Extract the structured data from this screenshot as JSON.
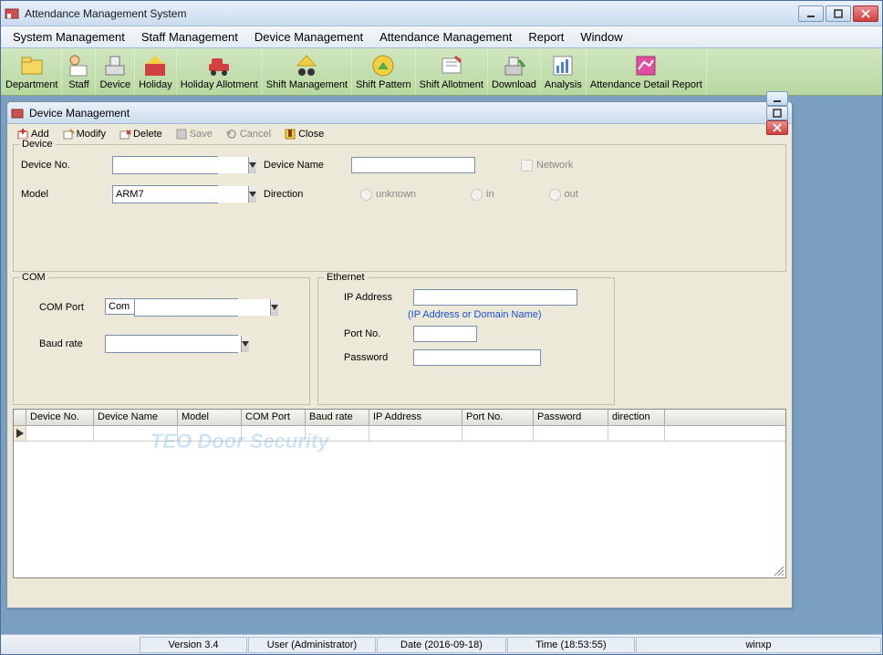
{
  "main_title": "Attendance Management System",
  "menubar": [
    "System Management",
    "Staff Management",
    "Device Management",
    "Attendance Management",
    "Report",
    "Window"
  ],
  "toolbar": [
    {
      "label": "Department",
      "icon": "dept"
    },
    {
      "label": "Staff",
      "icon": "staff"
    },
    {
      "label": "Device",
      "icon": "device"
    },
    {
      "label": "Holiday",
      "icon": "holiday"
    },
    {
      "label": "Holiday Allotment",
      "icon": "holalot"
    },
    {
      "label": "Shift Management",
      "icon": "shiftmgmt"
    },
    {
      "label": "Shift Pattern",
      "icon": "shiftpat"
    },
    {
      "label": "Shift Allotment",
      "icon": "shiftalot"
    },
    {
      "label": "Download",
      "icon": "download"
    },
    {
      "label": "Analysis",
      "icon": "analysis"
    },
    {
      "label": "Attendance Detail Report",
      "icon": "report"
    }
  ],
  "child": {
    "title": "Device Management",
    "toolbar": [
      {
        "label": "Add",
        "icon": "add",
        "enabled": true
      },
      {
        "label": "Modify",
        "icon": "modify",
        "enabled": true
      },
      {
        "label": "Delete",
        "icon": "delete",
        "enabled": true
      },
      {
        "label": "Save",
        "icon": "save",
        "enabled": false
      },
      {
        "label": "Cancel",
        "icon": "cancel",
        "enabled": false
      },
      {
        "label": "Close",
        "icon": "close",
        "enabled": true
      }
    ]
  },
  "device_group": {
    "legend": "Device",
    "device_no_label": "Device No.",
    "device_no_value": "",
    "model_label": "Model",
    "model_value": "ARM7",
    "device_name_label": "Device Name",
    "device_name_value": "",
    "direction_label": "Direction",
    "network_label": "Network",
    "direction_options": [
      "unknown",
      "in",
      "out"
    ]
  },
  "com_group": {
    "legend": "COM",
    "com_port_label": "COM Port",
    "com_port_prefix": "Com",
    "com_port_value": "",
    "baud_label": "Baud rate",
    "baud_value": ""
  },
  "eth_group": {
    "legend": "Ethernet",
    "ip_label": "IP Address",
    "ip_value": "",
    "ip_hint": "(IP Address or Domain Name)",
    "port_label": "Port No.",
    "port_value": "",
    "pwd_label": "Password",
    "pwd_value": ""
  },
  "grid_columns": [
    "Device No.",
    "Device Name",
    "Model",
    "COM Port",
    "Baud rate",
    "IP Address",
    "Port No.",
    "Password",
    "direction"
  ],
  "grid_col_widths": [
    74,
    92,
    70,
    70,
    70,
    102,
    78,
    82,
    62
  ],
  "statusbar": {
    "version": "Version 3.4",
    "user": "User (Administrator)",
    "date": "Date (2016-09-18)",
    "time": "Time (18:53:55)",
    "host": "winxp"
  },
  "watermark": "TEO Door Security"
}
